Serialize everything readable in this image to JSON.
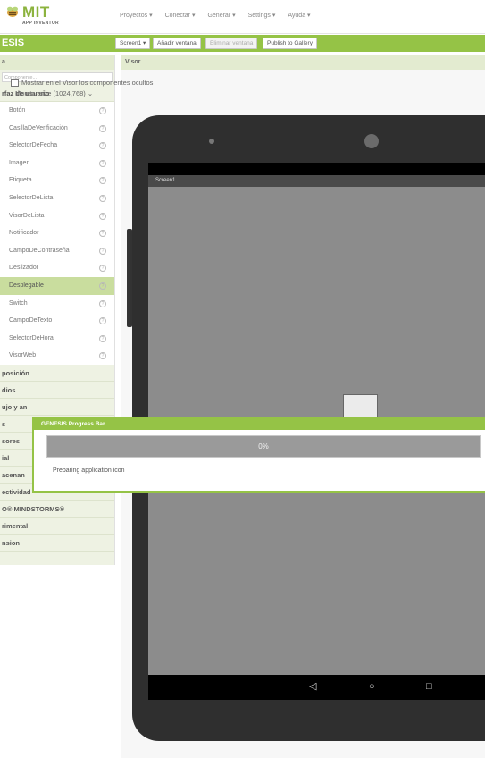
{
  "app": {
    "logo_text": "MIT",
    "logo_sub": "APP INVENTOR"
  },
  "topmenu": [
    "Proyectos ▾",
    "Conectar ▾",
    "Generar ▾",
    "Settings ▾",
    "Ayuda ▾"
  ],
  "project": {
    "name": "ESIS",
    "screen_select": "Screen1 ▾",
    "add_screen": "Añadir ventana",
    "remove_screen": "Eliminar ventana",
    "publish": "Publish to Gallery"
  },
  "palette": {
    "header": "a",
    "search_placeholder": "Componente...",
    "open_category": "rfaz de usuario",
    "items": [
      "Botón",
      "CasillaDeVerificación",
      "SelectorDeFecha",
      "Imagen",
      "Etiqueta",
      "SelectorDeLista",
      "VisorDeLista",
      "Notificador",
      "CampoDeContraseña",
      "Deslizador",
      "Desplegable",
      "Switch",
      "CampoDeTexto",
      "SelectorDeHora",
      "VisorWeb"
    ],
    "selected_item": "Desplegable",
    "help_glyph": "?",
    "categories": [
      "posición",
      "dios",
      "ujo y an",
      "s",
      "sores",
      "ial",
      "acenan",
      "ectividad",
      "O® MINDSTORMS®",
      "rimental",
      "nsion"
    ]
  },
  "viewer": {
    "header": "Visor",
    "show_hidden_label": "Mostrar en el Visor los componentes ocultos",
    "monitor_size": "Monitor size (1024,768)  ⌄",
    "screen_title": "Screen1"
  },
  "nav_icons": {
    "back": "◁",
    "home": "○",
    "recent": "□"
  },
  "progress_dialog": {
    "title": "GENESIS Progress Bar",
    "percent_text": "0%",
    "percent_value": 0,
    "status": "Preparing application icon"
  }
}
